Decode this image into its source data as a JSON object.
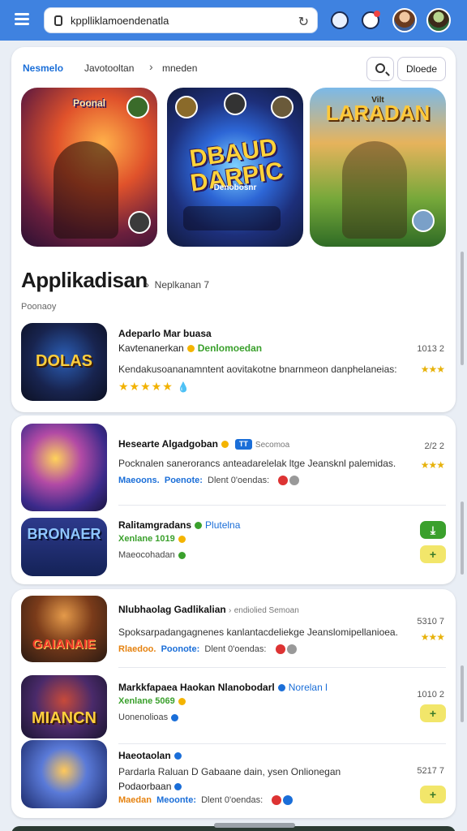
{
  "browser": {
    "url": "kpplliklamoendenatla"
  },
  "nav": {
    "active_tab": "Nesmelo",
    "tab2": "Javotooltan",
    "tab3": "mneden",
    "details_button": "Dloede"
  },
  "featured": {
    "game1_caption": "Poonal",
    "game2_title": "DBAUD DARPIC",
    "game2_sub": "Denobosnr",
    "game3_title": "LARADAN",
    "game3_sub": "Vilt"
  },
  "section": {
    "title": "Applikadisan",
    "link": "Neplkanan 7",
    "subtitle": "Poonaoy"
  },
  "apps": [
    {
      "title": "Adeparlo Mar buasa",
      "line2_a": "Kavtenanerkan",
      "line2_tag": "Denlomoedan",
      "desc": "Kendakusoananamntent aovitakotne bnarnmeon danphelaneias:",
      "number": "1013 2",
      "logo": "DOLAS"
    },
    {
      "title": "Hesearte Algadgoban",
      "chip": "TT",
      "title_extra": "Secomoa",
      "desc": "Pocknalen sanerorancs anteadarelelak ltge Jeansknl palemidas.",
      "meta_a": "Maeoons.",
      "meta_b": "Poenote:",
      "meta_c": "Dlent 0'oendas:",
      "number": "2/2 2"
    },
    {
      "title": "Ralitamgradans",
      "title_tag": "Plutelna",
      "line2_a": "Xenlane 1019",
      "meta_a": "Maeocohadan",
      "logo": "BRONAER"
    },
    {
      "title": "Nlubhaolag Gadlikalian",
      "title_extra": "endiolied Semoan",
      "desc": "Spoksarpadangagnenes kanlantacdeliekge Jeanslomipellanioea.",
      "meta_a": "Rlaedoo.",
      "meta_b": "Poonote:",
      "meta_c": "Dlent 0'oendas:",
      "number": "5310 7",
      "logo": "GAIANAIE"
    },
    {
      "title": "Markkfapaea Haokan Nlanobodarl",
      "title_extra": "Norelan l",
      "line2_a": "Xenlane 5069",
      "meta_a": "Uonenolioas",
      "number": "1010 2",
      "logo": "MIANCN"
    },
    {
      "title": "Haeotaolan",
      "desc": "Pardarla Raluan D Gabaane dain, ysen Onlionegan",
      "line3": "Podaorbaan",
      "meta_a": "Maedan",
      "meta_b": "Meoonte:",
      "meta_c": "Dlent 0'oendas:",
      "number": "5217 7"
    }
  ],
  "colors": {
    "topbar": "#3f82e0",
    "accent_blue": "#1a6ed8",
    "accent_green": "#3aa02c",
    "star": "#f2b200"
  },
  "icons": [
    "menu-icon",
    "lock-icon",
    "reload-icon",
    "extension-icon",
    "notification-icon",
    "search-icon",
    "star-icon",
    "download-icon",
    "plus-icon"
  ]
}
